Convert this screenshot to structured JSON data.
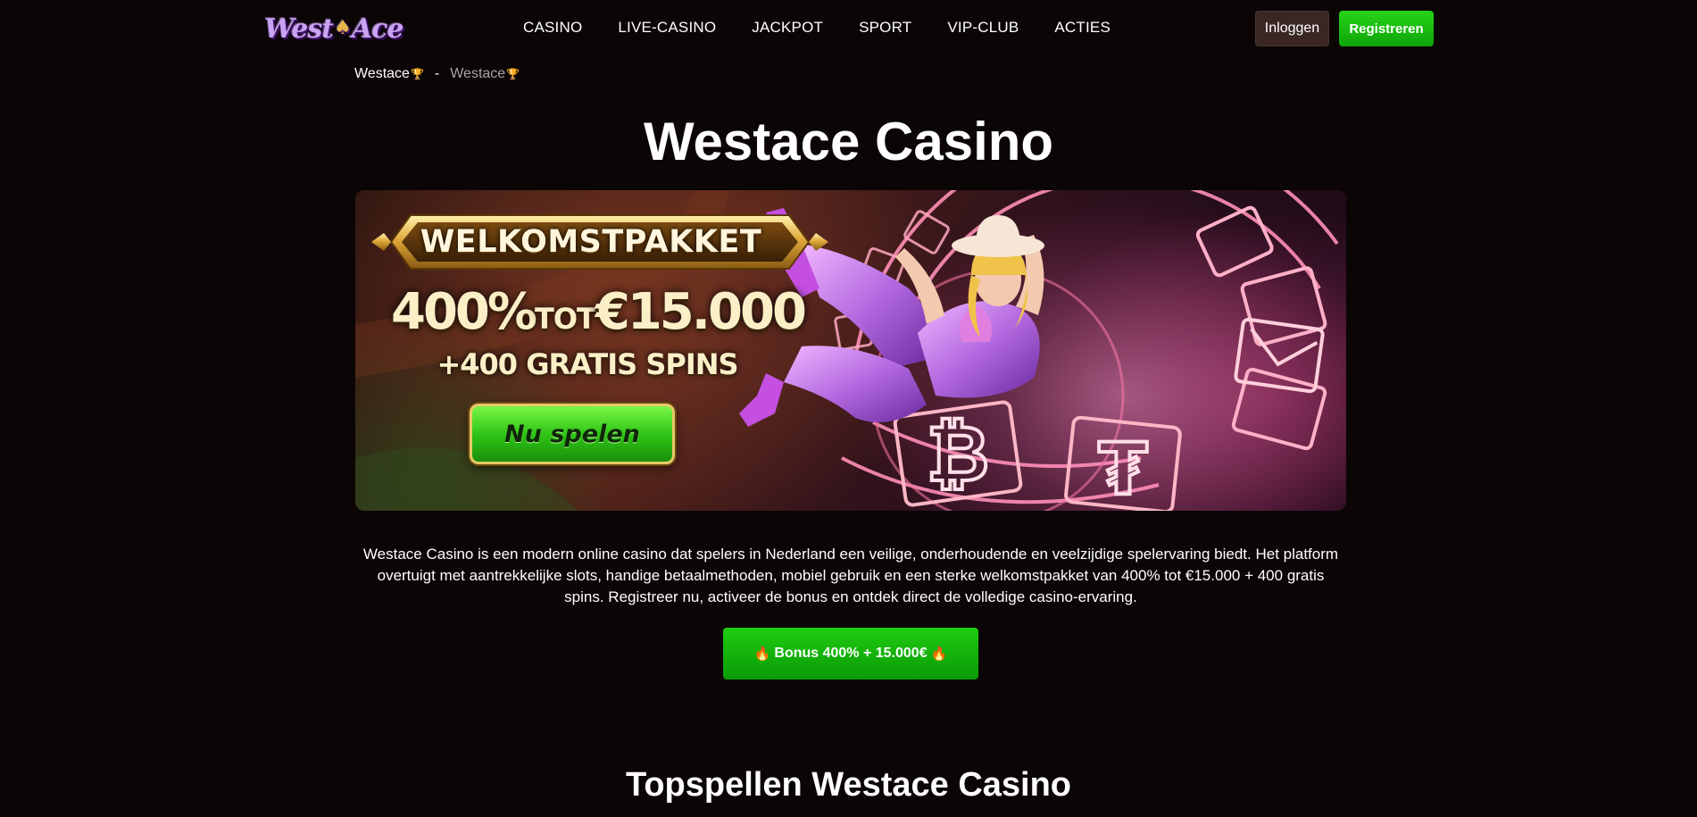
{
  "header": {
    "logo_text_left": "West",
    "logo_text_right": "Ace",
    "nav": [
      {
        "label": "CASINO"
      },
      {
        "label": "LIVE-CASINO"
      },
      {
        "label": "JACKPOT"
      },
      {
        "label": "SPORT"
      },
      {
        "label": "VIP-CLUB"
      },
      {
        "label": "ACTIES"
      }
    ],
    "login_label": "Inloggen",
    "register_label": "Registreren"
  },
  "breadcrumb": {
    "home": "Westace",
    "separator": "-",
    "current": "Westace",
    "icon": "trophy-icon"
  },
  "page_title": "Westace Casino",
  "banner": {
    "welcome": "WELKOMSTPAKKET",
    "amount_percent": "400%",
    "amount_tot": "TOT",
    "amount_value": "€15.000",
    "spins": "+400 GRATIS SPINS",
    "cta": "Nu spelen",
    "icons": [
      "bitcoin-icon",
      "tether-icon",
      "envelope-icon",
      "cowgirl-illustration"
    ]
  },
  "intro_text": "Westace Casino is een modern online casino dat spelers in Nederland een veilige, onderhoudende en veelzijdige spelervaring biedt. Het platform overtuigt met aantrekkelijke slots, handige betaalmethoden, mobiel gebruik en een sterke welkomstpakket van 400% tot €15.000 + 400 gratis spins. Registreer nu, activeer de bonus en ontdek direct de volledige casino-ervaring.",
  "bonus_button": {
    "label": "Bonus 400% + 15.000€",
    "icon": "fire-icon"
  },
  "section_title": "Topspellen Westace Casino",
  "colors": {
    "background": "#0b0506",
    "register_green": "#1fcc10",
    "login_brown": "#3a2723",
    "gold": "#e9c86a"
  }
}
